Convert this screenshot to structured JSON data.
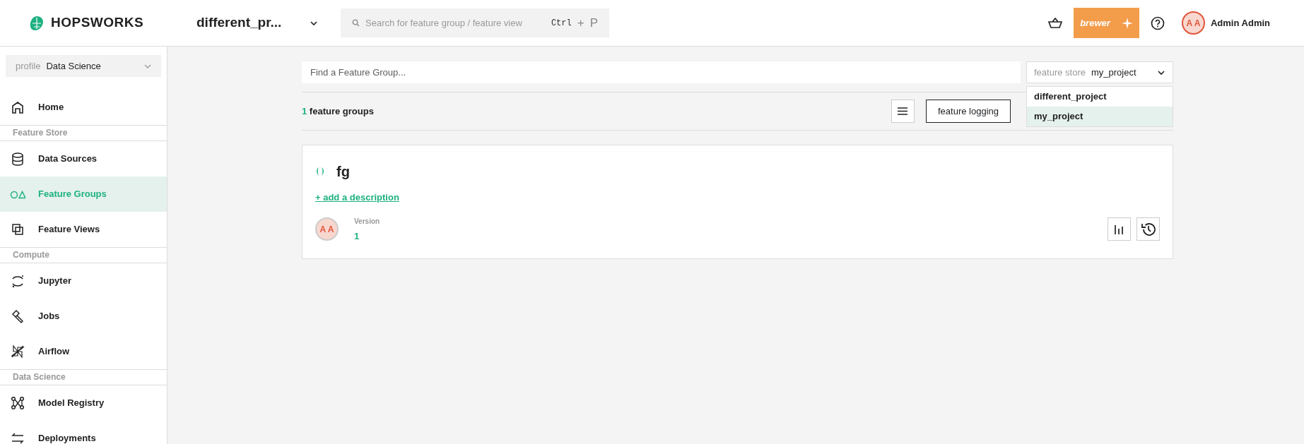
{
  "header": {
    "brand": "HOPSWORKS",
    "project": "different_pr...",
    "search": {
      "placeholder": "Search for feature group / feature view",
      "shortcut": [
        "Ctrl",
        "+",
        "P"
      ]
    },
    "assistant_button": "brewer",
    "user": {
      "initials": "A A",
      "name": "Admin Admin"
    }
  },
  "sidebar": {
    "profile": {
      "label": "profile",
      "value": "Data Science"
    },
    "items": [
      {
        "kind": "link",
        "label": "Home",
        "selected": false
      },
      {
        "kind": "section",
        "label": "Feature Store"
      },
      {
        "kind": "link",
        "label": "Data Sources",
        "selected": false
      },
      {
        "kind": "link",
        "label": "Feature Groups",
        "selected": true
      },
      {
        "kind": "link",
        "label": "Feature Views",
        "selected": false
      },
      {
        "kind": "section",
        "label": "Compute"
      },
      {
        "kind": "link",
        "label": "Jupyter",
        "selected": false
      },
      {
        "kind": "link",
        "label": "Jobs",
        "selected": false
      },
      {
        "kind": "link",
        "label": "Airflow",
        "selected": false
      },
      {
        "kind": "section",
        "label": "Data Science"
      },
      {
        "kind": "link",
        "label": "Model Registry",
        "selected": false
      },
      {
        "kind": "link",
        "label": "Deployments",
        "selected": false
      }
    ]
  },
  "main": {
    "search": {
      "placeholder": "Find a Feature Group..."
    },
    "store_select": {
      "label": "feature store",
      "value": "my_project",
      "expanded": true,
      "options": [
        {
          "label": "different_project",
          "selected": false
        },
        {
          "label": "my_project",
          "selected": true
        }
      ]
    },
    "count": {
      "number": "1",
      "label": "feature groups"
    },
    "toolbar": {
      "logging_button": "feature logging"
    },
    "cards": [
      {
        "title": "fg",
        "add_description": "+ add a description",
        "owner_initials": "A A",
        "version_label": "Version",
        "version": "1"
      }
    ]
  }
}
